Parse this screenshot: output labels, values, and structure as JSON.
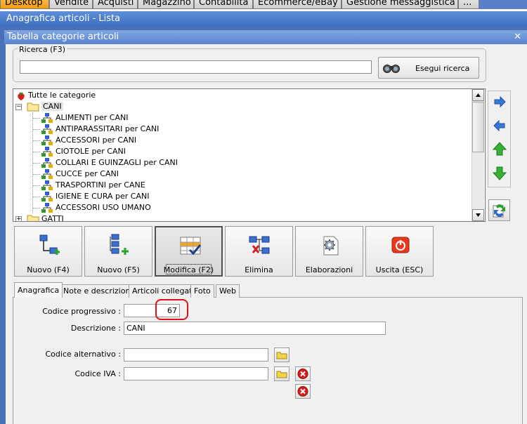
{
  "menu_tabs": [
    "Desktop",
    "Vendite",
    "Acquisti",
    "Magazzino",
    "Contabilità",
    "Ecommerce/eBay",
    "Gestione messaggistica",
    "..."
  ],
  "app_title": "Anagrafica articoli  - Lista",
  "window_title": "Tabella categorie articoli",
  "search": {
    "label": "Ricerca (F3)",
    "value": "",
    "button_label": "Esegui ricerca"
  },
  "tree": {
    "root": "Tutte le categorie",
    "folders": [
      {
        "name": "CANI",
        "expanded": true,
        "children": [
          "ALIMENTI per CANI",
          "ANTIPARASSITARI per CANI",
          "ACCESSORI per CANI",
          "CIOTOLE per CANI",
          "COLLARI E GUINZAGLI per CANI",
          "CUCCE per CANI",
          "TRASPORTINI per CANE",
          "IGIENE E CURA per CANI",
          "ACCESSORI USO UMANO"
        ]
      },
      {
        "name": "GATTI",
        "expanded": false,
        "children": []
      }
    ]
  },
  "toolbar": {
    "new_f4": "Nuovo (F4)",
    "new_f5": "Nuovo (F5)",
    "edit": "Modifica (F2)",
    "delete": "Elimina",
    "process": "Elaborazioni",
    "exit": "Uscita (ESC)"
  },
  "tabs": [
    "Anagrafica",
    "Note e descrizioni",
    "Articoli collegati",
    "Foto",
    "Web"
  ],
  "form": {
    "codice_progressivo_label": "Codice progressivo :",
    "codice_progressivo_value": "67",
    "descrizione_label": "Descrizione :",
    "descrizione_value": "CANI",
    "codice_alternativo_label": "Codice alternativo :",
    "codice_alternativo_value": "",
    "codice_iva_label": "Codice IVA :",
    "codice_iva_value": ""
  },
  "colors": {
    "active_tab": "#f39a10",
    "title_bar": "#3c6ec0",
    "highlight_oval": "#e0101a"
  }
}
